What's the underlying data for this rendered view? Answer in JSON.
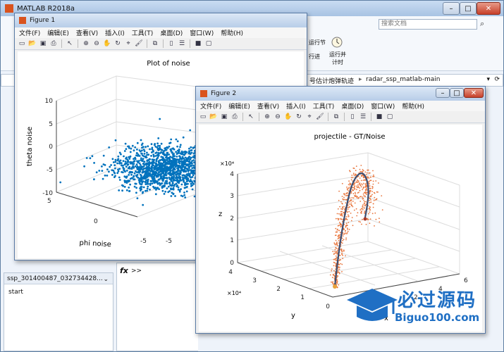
{
  "matlab": {
    "title": "MATLAB R2018a",
    "search_placeholder": "搜索文档",
    "ribbon_labels": [
      "运行节",
      "运行并\n计时"
    ],
    "ribbon_label_2": "运行并计时",
    "ribbon_small": "行进",
    "path_parts": [
      "号估计炮弹轨迹",
      "radar_ssp_matlab-main"
    ],
    "workspace_file": "ssp_301400487_032734428...",
    "workspace_item": "start",
    "command_prompt": ">>",
    "fx": "fx"
  },
  "figure1": {
    "title": "Figure 1",
    "menu": [
      "文件(F)",
      "编辑(E)",
      "查看(V)",
      "插入(I)",
      "工具(T)",
      "桌面(D)",
      "窗口(W)",
      "帮助(H)"
    ],
    "plot_title": "Plot of noise",
    "xlabel": "phi noise",
    "ylabel": "theta noise",
    "z_ticks": [
      "10",
      "5",
      "0",
      "-5",
      "-10"
    ],
    "x_ticks": [
      "5",
      "0",
      "-5"
    ],
    "y_ticks": [
      "-5"
    ]
  },
  "figure2": {
    "title": "Figure 2",
    "menu": [
      "文件(F)",
      "编辑(E)",
      "查看(V)",
      "插入(I)",
      "工具(T)",
      "桌面(D)",
      "窗口(W)",
      "帮助(H)"
    ],
    "plot_title": "projectile - GT/Noise",
    "zlabel": "z",
    "ylabel": "y",
    "xlabel": "x",
    "z_exp": "×10⁴",
    "y_exp": "×10⁴",
    "z_ticks": [
      "4",
      "3",
      "2",
      "1",
      "0"
    ],
    "y_ticks": [
      "4",
      "3",
      "2",
      "1",
      "0"
    ],
    "x_ticks": [
      "6",
      "4",
      "2"
    ],
    "colors": {
      "gt": "#3b4f73",
      "noise": "#e8743b"
    }
  },
  "watermark": {
    "brand": "必过源码",
    "url": "Biguo100.com"
  },
  "colors": {
    "scatter": "#0072bd",
    "title_bar": "#b8cde8"
  }
}
